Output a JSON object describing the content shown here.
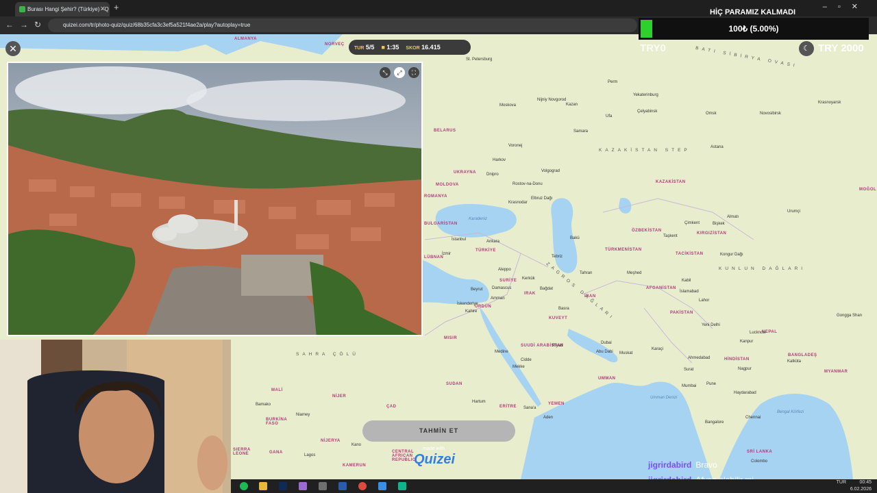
{
  "browser": {
    "tab_title": "Burası Hangi Şehir? (Türkiye) - Q",
    "url": "quizei.com/tr/photo-quiz/quiz/68b35cfa3c3ef5a521f4ae2a/play?autoplay=true"
  },
  "quiz": {
    "round_label": "TUR",
    "round_value": "5/5",
    "timer_value": "1:35",
    "score_label": "SKOR",
    "score_value": "16.415",
    "guess_button": "TAHMİN ET",
    "made_with": "made with",
    "logo": "Quizei"
  },
  "overlay": {
    "donation_title": "HİÇ PARAMIZ KALMADI",
    "donation_text": "100₺ (5.00%)",
    "donation_progress": 0.05,
    "try_left": "TRY0",
    "try_right": "TRY 2000",
    "chat": [
      {
        "user": "jigrirdabird",
        "message": "Bravo"
      },
      {
        "user": "jigrirdabird",
        "message": "Afyon olabilir mi"
      }
    ]
  },
  "map": {
    "countries": [
      "TÜRKİYE",
      "UKRAYNA",
      "BELARUS",
      "MOLDOVA",
      "KAZAKİSTAN",
      "ÖZBEKİSTAN",
      "TÜRKMENİSTAN",
      "KIRGIZİSTAN",
      "TACİKİSTAN",
      "AFGANİSTAN",
      "PAKİSTAN",
      "HİNDİSTAN",
      "İRAN",
      "IRAK",
      "SURİYE",
      "MISIR",
      "SUUDİ ARABİSTAN",
      "YEMEN",
      "UMMAN",
      "NEPAL",
      "BANGLADEŞ",
      "MYANMAR",
      "SRİ LANKA",
      "ÇAD",
      "NİJER",
      "MALİ",
      "NİJERYA",
      "ERİTRE",
      "KUVEYT",
      "MOĞOL",
      "SUDAN",
      "GANA",
      "BURKİNA FASO",
      "CENTRAL AFRICAN REPUBLIC",
      "KAMERUN",
      "LÜBNAN",
      "ROMANYA",
      "BULGARİSTAN",
      "ÜRDÜN",
      "NORVEÇ",
      "ALMANYA",
      "SIERRA LEONE"
    ],
    "cities": [
      "Moskova",
      "St. Petersburg",
      "Kazan",
      "Nijniy Novgorod",
      "Samara",
      "Voronej",
      "Harkov",
      "Dnipro",
      "Volgograd",
      "Rostov-na-Donu",
      "Krasnodar",
      "İstanbul",
      "İzmir",
      "Ankara",
      "Aleppo",
      "Beyrut",
      "Damascus",
      "Amman",
      "Kahire",
      "İskenderiye",
      "Bağdat",
      "Tahran",
      "Meşhed",
      "Basra",
      "Kabil",
      "İslamabad",
      "Lahor",
      "Yeni Delhi",
      "Karaçi",
      "Mumbai",
      "Pune",
      "Haydarabad",
      "Bangalore",
      "Chennai",
      "Kalküta",
      "Dubai",
      "Abu Dabi",
      "Muskat",
      "Riyad",
      "Medine",
      "Mekke",
      "Cidde",
      "Hartum",
      "Sana'a",
      "Aden",
      "Lagos",
      "Kano",
      "Yekaterinburg",
      "Omsk",
      "Novosibirsk",
      "Çelyabinsk",
      "Ufa",
      "Perm",
      "Taşkent",
      "Bişkek",
      "Almatı",
      "Urumçi",
      "Astana",
      "Krasnoyarsk",
      "Tebriz",
      "Kerkük",
      "Bakü",
      "Çimkent",
      "Kongur Dağı",
      "Elbruz Dağı",
      "Gongga Shan",
      "Lucknow",
      "Kanpur",
      "Nagpur",
      "Surat",
      "Ahmedabad",
      "Colombo",
      "Bamako",
      "Niamey"
    ],
    "regions": [
      "KAZAKİSTAN STEP",
      "KUNLUN DAĞLARI",
      "SAHRA ÇÖLÜ",
      "ZAGROS DAĞLARI",
      "BATI SİBİRYA OVASI"
    ],
    "seas": [
      "Karadeniz",
      "Umman Denizi",
      "Bengal Körfezi"
    ]
  },
  "taskbar": {
    "lang": "TUR",
    "time": "00:45",
    "date": "6.02.2026"
  }
}
